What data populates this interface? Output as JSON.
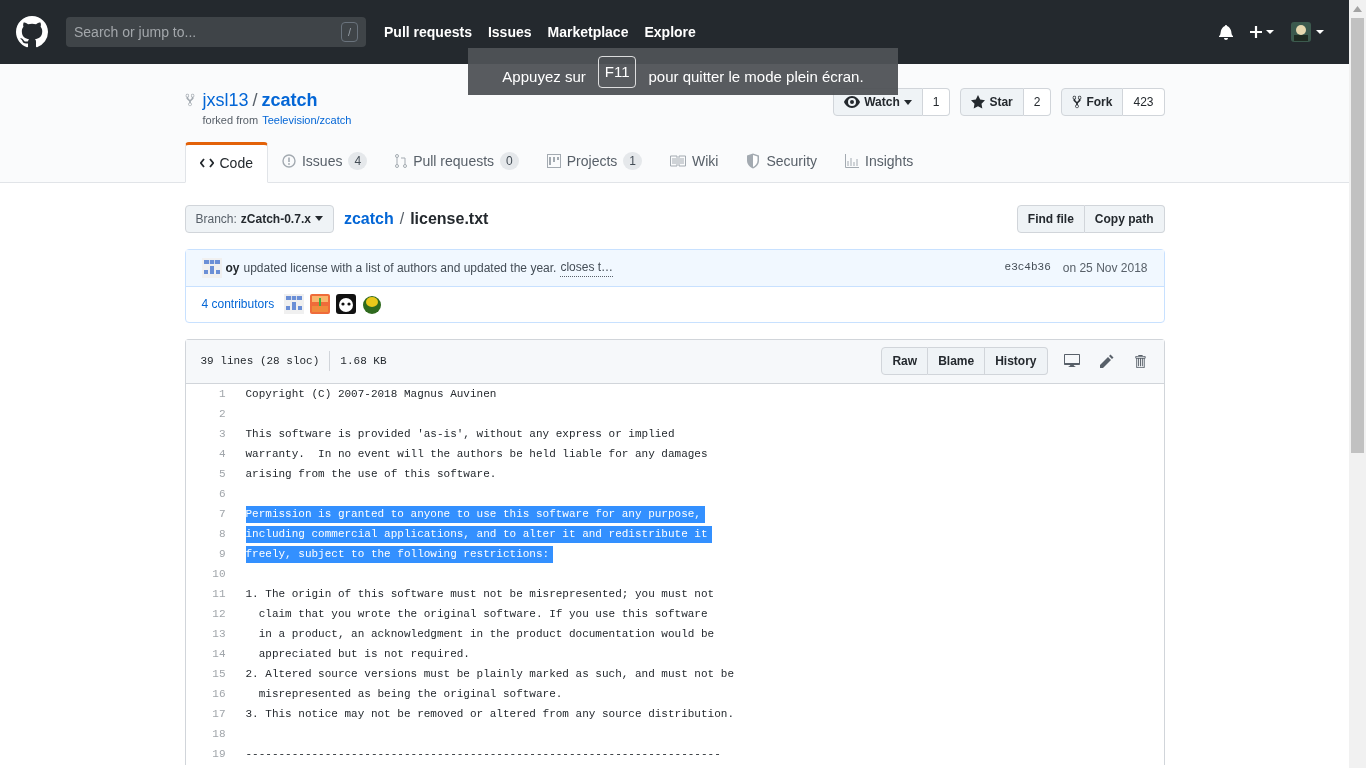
{
  "header": {
    "search": {
      "placeholder": "Search or jump to...",
      "shortcut": "/"
    },
    "nav": [
      "Pull requests",
      "Issues",
      "Marketplace",
      "Explore"
    ]
  },
  "fullscreen_notice": {
    "before": "Appuyez sur",
    "key": "F11",
    "after": "pour quitter le mode plein écran."
  },
  "repo": {
    "owner": "jxsl13",
    "separator": "/",
    "name": "zcatch",
    "forked_from_label": "forked from",
    "forked_from": "Teelevision/zcatch",
    "actions": [
      {
        "kind": "watch",
        "label": "Watch",
        "count": "1"
      },
      {
        "kind": "star",
        "label": "Star",
        "count": "2"
      },
      {
        "kind": "fork",
        "label": "Fork",
        "count": "423"
      }
    ]
  },
  "tabs": [
    {
      "kind": "code",
      "label": "Code",
      "selected": true
    },
    {
      "kind": "issues",
      "label": "Issues",
      "count": "4",
      "selected": false
    },
    {
      "kind": "pulls",
      "label": "Pull requests",
      "count": "0",
      "selected": false
    },
    {
      "kind": "projects",
      "label": "Projects",
      "count": "1",
      "selected": false
    },
    {
      "kind": "wiki",
      "label": "Wiki",
      "selected": false
    },
    {
      "kind": "security",
      "label": "Security",
      "selected": false
    },
    {
      "kind": "insights",
      "label": "Insights",
      "selected": false
    }
  ],
  "breadcrumb": {
    "branch_label": "Branch:",
    "branch": "zCatch-0.7.x",
    "root": "zcatch",
    "separator": "/",
    "file": "license.txt"
  },
  "file_actions": [
    "Find file",
    "Copy path"
  ],
  "commit": {
    "author": "oy",
    "message": "updated license with a list of authors and updated the year.",
    "more": "closes t…",
    "sha": "e3c4b36",
    "date": "on 25 Nov 2018",
    "contributors": "4 contributors"
  },
  "file": {
    "lines_info": "39 lines (28 sloc)",
    "size": "1.68 KB",
    "buttons": [
      "Raw",
      "Blame",
      "History"
    ],
    "lines": [
      {
        "number": "1",
        "text": "Copyright (C) 2007-2018 Magnus Auvinen",
        "selected": false
      },
      {
        "number": "2",
        "selected": false
      },
      {
        "number": "3",
        "text": "This software is provided 'as-is', without any express or implied",
        "selected": false
      },
      {
        "number": "4",
        "text": "warranty.  In no event will the authors be held liable for any damages",
        "selected": false
      },
      {
        "number": "5",
        "text": "arising from the use of this software.",
        "selected": false
      },
      {
        "number": "6",
        "selected": false
      },
      {
        "number": "7",
        "text": "Permission is granted to anyone to use this software for any purpose,",
        "selected": true
      },
      {
        "number": "8",
        "text": "including commercial applications, and to alter it and redistribute it",
        "selected": true
      },
      {
        "number": "9",
        "text": "freely, subject to the following restrictions:",
        "selected": true
      },
      {
        "number": "10",
        "selected": false
      },
      {
        "number": "11",
        "text": "1. The origin of this software must not be misrepresented; you must not",
        "selected": false
      },
      {
        "number": "12",
        "text": "  claim that you wrote the original software. If you use this software",
        "selected": false
      },
      {
        "number": "13",
        "text": "  in a product, an acknowledgment in the product documentation would be",
        "selected": false
      },
      {
        "number": "14",
        "text": "  appreciated but is not required.",
        "selected": false
      },
      {
        "number": "15",
        "text": "2. Altered source versions must be plainly marked as such, and must not be",
        "selected": false
      },
      {
        "number": "16",
        "text": "  misrepresented as being the original software.",
        "selected": false
      },
      {
        "number": "17",
        "text": "3. This notice may not be removed or altered from any source distribution.",
        "selected": false
      },
      {
        "number": "18",
        "selected": false
      },
      {
        "number": "19",
        "text": "------------------------------------------------------------------------",
        "selected": false
      }
    ]
  }
}
